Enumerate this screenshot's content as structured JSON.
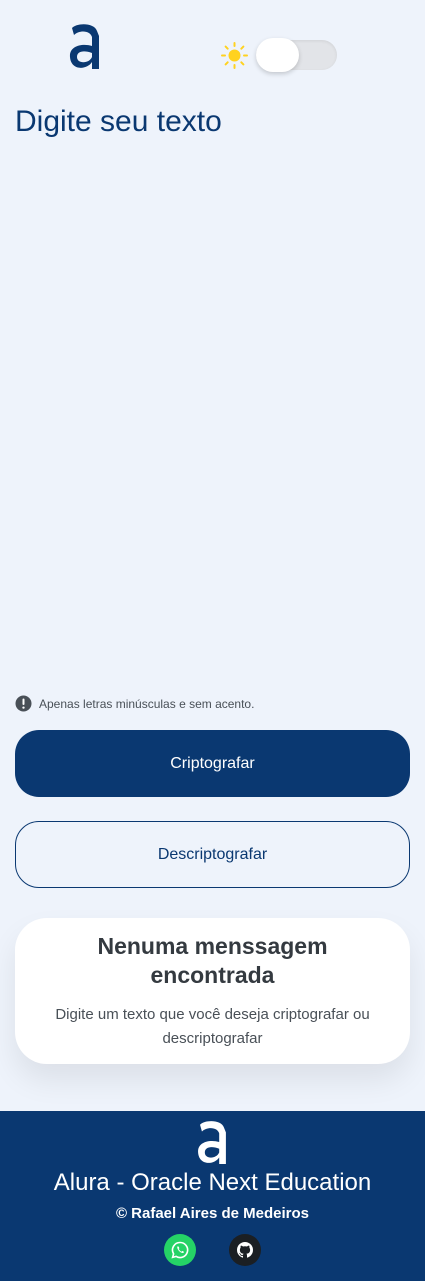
{
  "header": {
    "logo_icon": "alura-logo-icon",
    "theme_toggle": {
      "icon": "sun-icon",
      "state": "light"
    }
  },
  "input": {
    "placeholder": "Digite seu texto",
    "value": ""
  },
  "warning": {
    "icon": "exclamation-circle-icon",
    "text": "Apenas letras minúsculas e sem acento."
  },
  "buttons": {
    "encrypt_label": "Criptografar",
    "decrypt_label": "Descriptografar"
  },
  "output": {
    "title": "Nenuma menssagem encontrada",
    "subtitle": "Digite um texto que você deseja criptografar ou descriptografar"
  },
  "footer": {
    "logo_icon": "alura-logo-icon",
    "title": "Alura - Oracle Next Education",
    "credit": "© Rafael Aires de Medeiros",
    "social": [
      {
        "icon": "whatsapp-icon",
        "color": "#25d366"
      },
      {
        "icon": "github-icon",
        "color": "#1b1f23"
      }
    ]
  },
  "colors": {
    "brand": "#0a3871",
    "background": "#eef3fb",
    "sun": "#ffd21f"
  }
}
